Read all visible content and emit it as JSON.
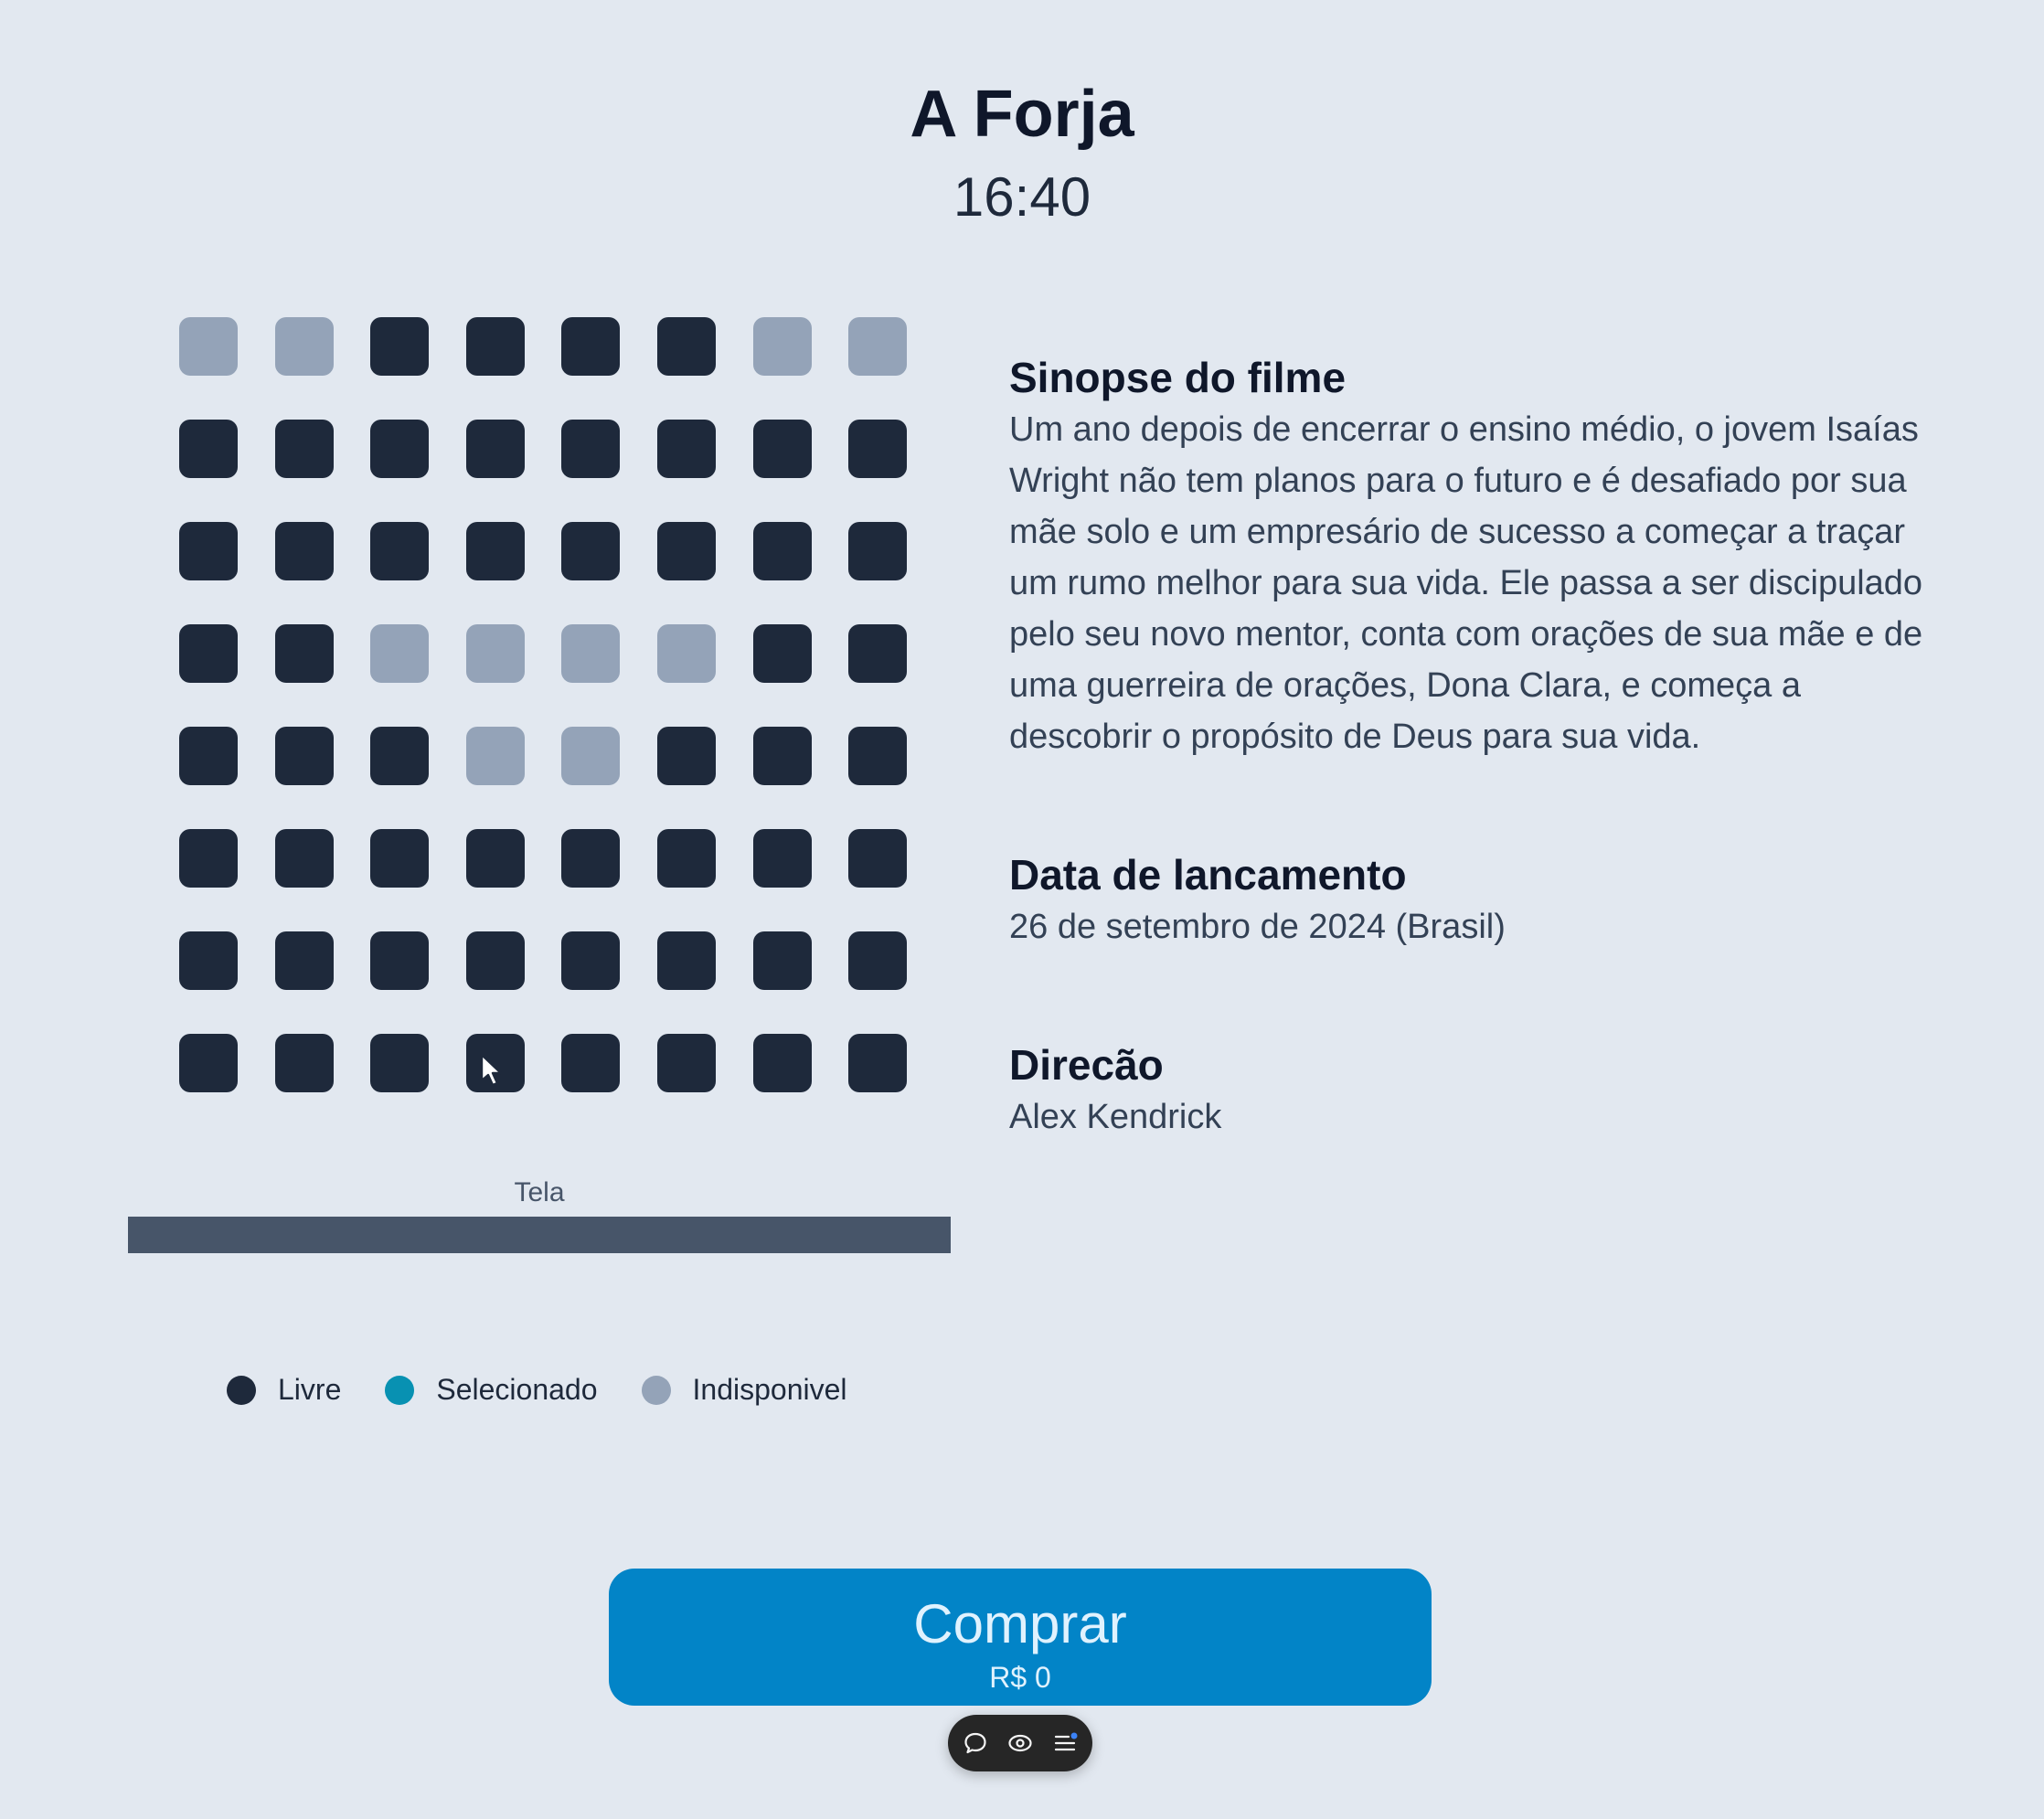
{
  "movie": {
    "title": "A Forja",
    "time": "16:40"
  },
  "seats": {
    "rows": [
      [
        "unavailable",
        "unavailable",
        "free",
        "free",
        "free",
        "free",
        "unavailable",
        "unavailable"
      ],
      [
        "free",
        "free",
        "free",
        "free",
        "free",
        "free",
        "free",
        "free"
      ],
      [
        "free",
        "free",
        "free",
        "free",
        "free",
        "free",
        "free",
        "free"
      ],
      [
        "free",
        "free",
        "unavailable",
        "unavailable",
        "unavailable",
        "unavailable",
        "free",
        "free"
      ],
      [
        "free",
        "free",
        "free",
        "unavailable",
        "unavailable",
        "free",
        "free",
        "free"
      ],
      [
        "free",
        "free",
        "free",
        "free",
        "free",
        "free",
        "free",
        "free"
      ],
      [
        "free",
        "free",
        "free",
        "free",
        "free",
        "free",
        "free",
        "free"
      ],
      [
        "free",
        "free",
        "free",
        "free",
        "free",
        "free",
        "free",
        "free"
      ]
    ]
  },
  "screen": {
    "label": "Tela"
  },
  "legend": {
    "free": {
      "label": "Livre",
      "color": "#1e293b"
    },
    "selected": {
      "label": "Selecionado",
      "color": "#0891b2"
    },
    "unavailable": {
      "label": "Indisponivel",
      "color": "#94a3b8"
    }
  },
  "info": {
    "synopsis_heading": "Sinopse do filme",
    "synopsis_text": "Um ano depois de encerrar o ensino médio, o jovem Isaías Wright não tem planos para o futuro e é desafiado por sua mãe solo e um empresário de sucesso a começar a traçar um rumo melhor para sua vida. Ele passa a ser discipulado pelo seu novo mentor, conta com orações de sua mãe e de uma guerreira de orações, Dona Clara, e começa a descobrir o propósito de Deus para sua vida.",
    "release_heading": "Data de lancamento",
    "release_text": "26 de setembro de 2024 (Brasil)",
    "direction_heading": "Direcão",
    "direction_text": "Alex Kendrick"
  },
  "buy": {
    "label": "Comprar",
    "price": "R$ 0"
  },
  "toolbar": {
    "icons": [
      "chat-bubble-icon",
      "eye-icon",
      "menu-list-icon"
    ]
  },
  "colors": {
    "background": "#e2e8f0",
    "seat_free": "#1e293b",
    "seat_unavailable": "#94a3b8",
    "seat_selected": "#0891b2",
    "buy_button": "#0284c7",
    "screen_bar": "#475569"
  }
}
